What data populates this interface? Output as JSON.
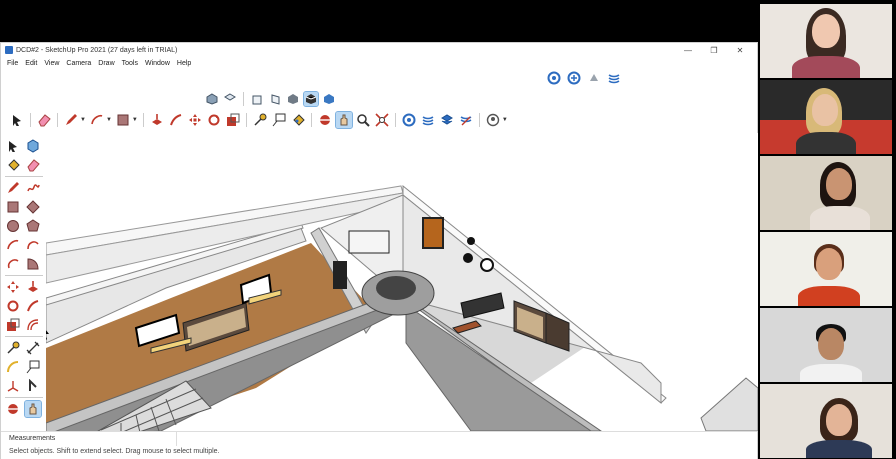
{
  "window": {
    "title": "DCD#2 - SketchUp Pro 2021 (27 days left in TRIAL)",
    "controls": [
      "—",
      "❐",
      "✕"
    ]
  },
  "menu": [
    "File",
    "Edit",
    "View",
    "Camera",
    "Draw",
    "Tools",
    "Window",
    "Help"
  ],
  "status": {
    "measurements_label": "Measurements",
    "hint": "Select objects. Shift to extend select. Drag mouse to select multiple."
  },
  "icons": {
    "select": "select-arrow-icon",
    "eraser": "eraser-icon",
    "pencil": "pencil-icon",
    "arc": "arc-icon",
    "rectangle": "rectangle-icon",
    "push_pull": "push-pull-icon",
    "follow_me": "follow-me-icon",
    "move": "move-icon",
    "rotate": "rotate-icon",
    "scale": "scale-icon",
    "tape": "tape-measure-icon",
    "text": "text-icon",
    "paint": "paint-bucket-icon",
    "orbit": "orbit-icon",
    "pan": "pan-icon",
    "zoom": "zoom-icon",
    "zoom_extents": "zoom-extents-icon",
    "warehouse": "3d-warehouse-icon",
    "extension": "extension-warehouse-icon",
    "layout": "layout-icon",
    "profile": "profile-icon"
  },
  "colors": {
    "floor": "#b07a45",
    "wall_top": "#f2f2f2",
    "wall_side": "#c9c9c9",
    "wall_dark": "#8f8f8f",
    "accent": "#2d6cc0"
  }
}
